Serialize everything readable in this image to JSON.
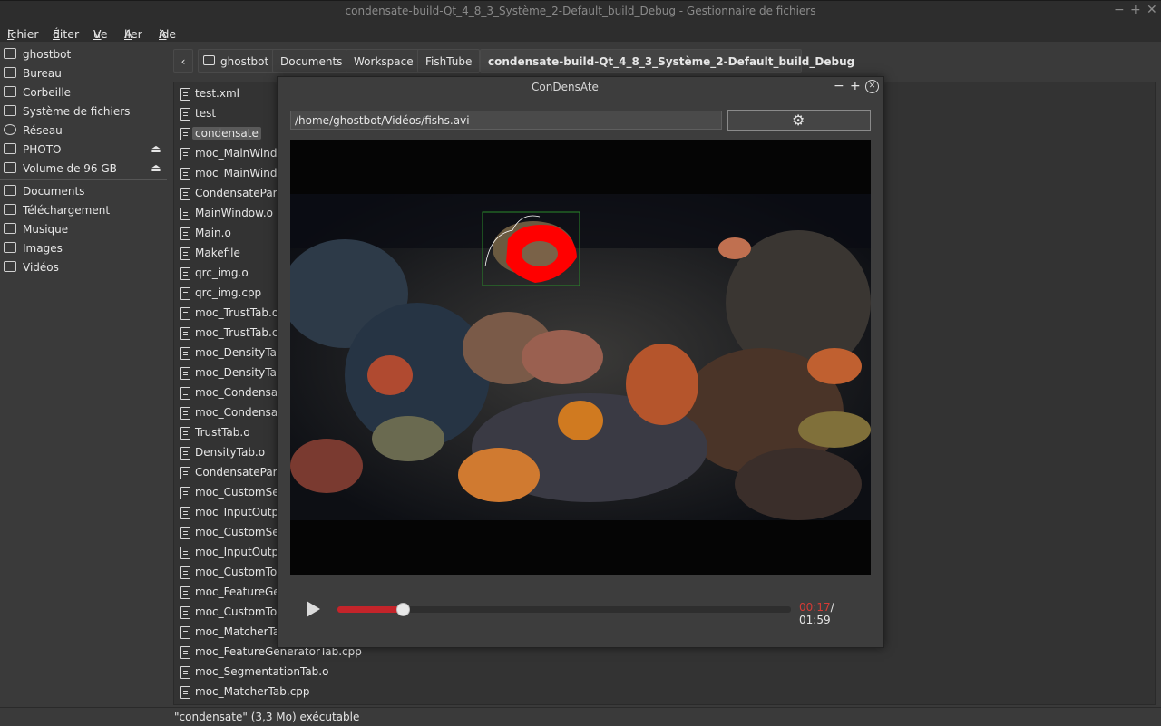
{
  "window": {
    "title": "condensate-build-Qt_4_8_3_Système_2-Default_build_Debug - Gestionnaire de fichiers",
    "minimize": "−",
    "maximize": "+",
    "close": "✕"
  },
  "menu": [
    {
      "first": "F",
      "rest": "ichier"
    },
    {
      "first": "É",
      "rest": "diter"
    },
    {
      "first": "V",
      "rest": "ue"
    },
    {
      "first": "A",
      "rest": "ller"
    },
    {
      "first": "A",
      "rest": "ide"
    }
  ],
  "sidebar": {
    "places": [
      {
        "label": "ghostbot",
        "icon": "home-folder-icon"
      },
      {
        "label": "Bureau",
        "icon": "desktop-icon"
      },
      {
        "label": "Corbeille",
        "icon": "trash-icon"
      },
      {
        "label": "Système de fichiers",
        "icon": "drive-icon"
      },
      {
        "label": "Réseau",
        "icon": "network-icon"
      },
      {
        "label": "PHOTO",
        "icon": "drive-icon",
        "eject": "⏏"
      },
      {
        "label": "Volume de 96 GB",
        "icon": "drive-icon",
        "eject": "⏏"
      }
    ],
    "bookmarks": [
      {
        "label": "Documents",
        "icon": "folder-icon"
      },
      {
        "label": "Téléchargement",
        "icon": "folder-icon"
      },
      {
        "label": "Musique",
        "icon": "folder-icon"
      },
      {
        "label": "Images",
        "icon": "folder-icon"
      },
      {
        "label": "Vidéos",
        "icon": "folder-icon"
      }
    ]
  },
  "pathbar": {
    "back": "‹",
    "crumbs": [
      "ghostbot",
      "Documents",
      "Workspace",
      "FishTube",
      "condensate-build-Qt_4_8_3_Système_2-Default_build_Debug"
    ]
  },
  "files": [
    "test.xml",
    "test",
    "condensate",
    "moc_MainWindow",
    "moc_MainWindow",
    "CondensateParam",
    "MainWindow.o",
    "Main.o",
    "Makefile",
    "qrc_img.o",
    "qrc_img.cpp",
    "moc_TrustTab.o",
    "moc_TrustTab.cpp",
    "moc_DensityTab.",
    "moc_DensityTab.",
    "moc_Condensate",
    "moc_Condensate",
    "TrustTab.o",
    "DensityTab.o",
    "CondensateParam",
    "moc_CustomSele",
    "moc_InputOutpu",
    "moc_CustomSele",
    "moc_InputOutpu",
    "moc_CustomTogg",
    "moc_FeatureGen",
    "moc_CustomTogg",
    "moc_MatcherTab",
    "moc_FeatureGeneratorTab.cpp",
    "moc_SegmentationTab.o",
    "moc_MatcherTab.cpp"
  ],
  "selected_file_index": 2,
  "status": "\"condensate\" (3,3 Mo) exécutable",
  "dialog": {
    "title": "ConDensAte",
    "minimize": "−",
    "maximize": "+",
    "close": "✕",
    "path_value": "/home/ghostbot/Vidéos/fishs.avi",
    "settings_icon": "⚙"
  },
  "player": {
    "current": "00:17",
    "total": "/ 01:59",
    "progress": 0.143
  },
  "colors": {
    "accent": "#c4242a",
    "detection": "#ff0000",
    "bbox": "#2a8a2a"
  }
}
